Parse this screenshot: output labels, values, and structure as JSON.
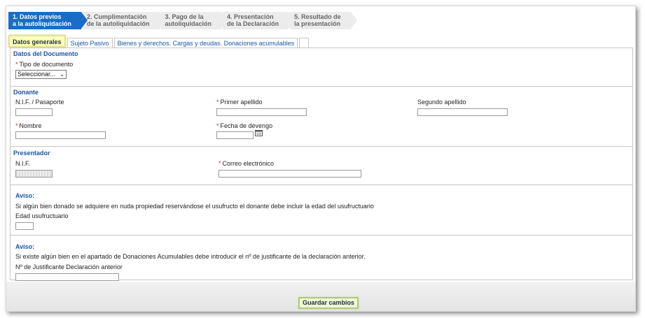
{
  "steps": [
    {
      "line1": "1. Datos previos",
      "line2": "a la autoliquidación"
    },
    {
      "line1": "2. Cumplimentación",
      "line2": "de la autoliquidación"
    },
    {
      "line1": "3. Pago de la",
      "line2": "autoliquidación"
    },
    {
      "line1": "4. Presentación",
      "line2": "de la Declaración"
    },
    {
      "line1": "5. Resultado de",
      "line2": "la presentación"
    }
  ],
  "tabs": [
    {
      "label": "Datos generales"
    },
    {
      "label": "Sujeto Pasivo"
    },
    {
      "label": "Bienes y derechos. Cargas y deudas. Donaciones acumulables"
    }
  ],
  "documento": {
    "title": "Datos del Documento",
    "tipo_label": "Tipo de documento",
    "tipo_value": "Seleccionar..."
  },
  "donante": {
    "title": "Donante",
    "nif_label": "N.I.F. / Pasaporte",
    "primer_apellido_label": "Primer apellido",
    "segundo_apellido_label": "Segundo apellido",
    "nombre_label": "Nombre",
    "fecha_label": "Fecha de devengo"
  },
  "presentador": {
    "title": "Presentador",
    "nif_label": "N.I.F.",
    "correo_label": "Correo electrónico"
  },
  "aviso1": {
    "title": "Aviso:",
    "text": "Si algún bien donado se adquiere en nuda propiedad reservándose el usufructo el donante debe incluir la edad del usufructuario",
    "edad_label": "Edad usufructuario"
  },
  "aviso2": {
    "title": "Aviso:",
    "text": "Si existe algún bien en el apartado de Donaciones Acumulables debe introducir el nº de justificante de la declaración anterior.",
    "justificante_label": "Nº de Justificante Declaración anterior"
  },
  "required_mark": "*",
  "save_label": "Guardar cambios",
  "colors": {
    "accent": "#1a6dc6",
    "required": "#c0392b",
    "active_tab": "#ffffb8"
  }
}
